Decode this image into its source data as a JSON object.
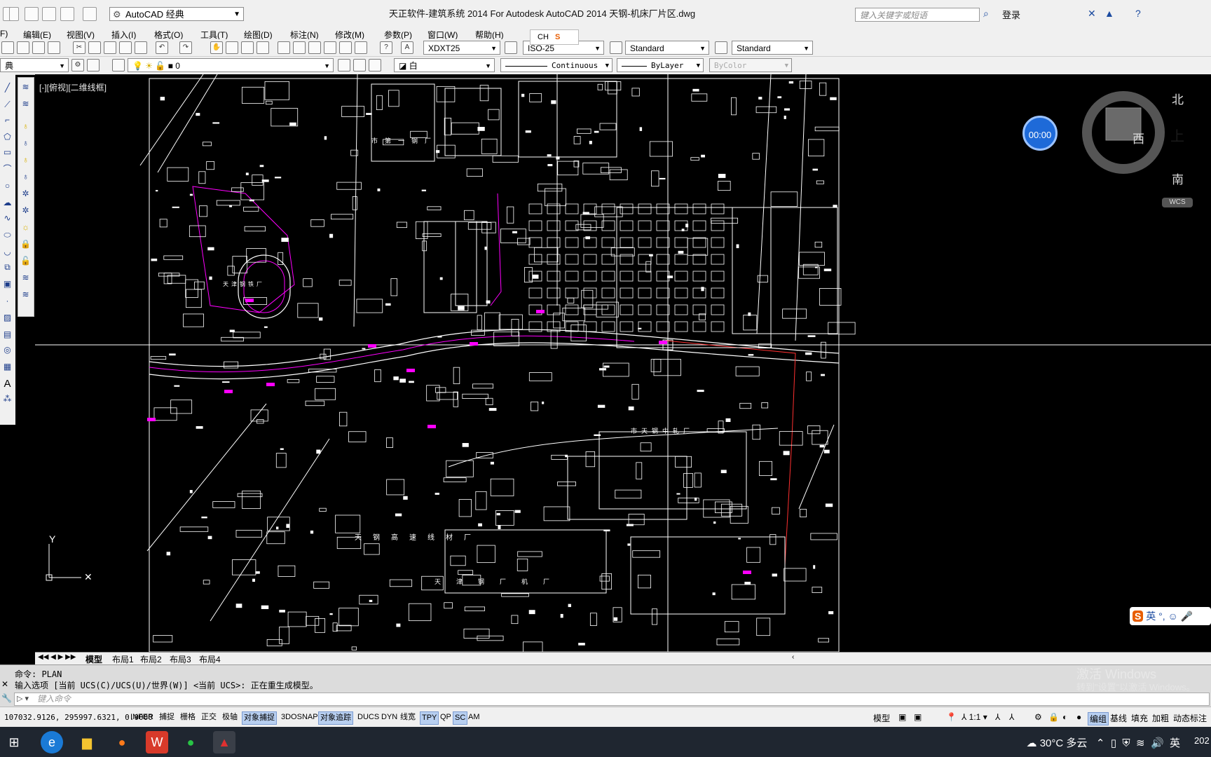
{
  "titlebar": {
    "workspace": "AutoCAD 经典",
    "title": "天正软件-建筑系统 2014  For Autodesk AutoCAD 2014      天钢-机床厂片区.dwg",
    "search_placeholder": "键入关键字或短语",
    "login": "登录"
  },
  "menu": [
    "F)",
    "编辑(E)",
    "视图(V)",
    "插入(I)",
    "格式(O)",
    "工具(T)",
    "绘图(D)",
    "标注(N)",
    "修改(M)",
    "参数(P)",
    "窗口(W)",
    "帮助(H)"
  ],
  "ime": {
    "label": "CH",
    "mode": "英"
  },
  "toolbar1": {
    "text_style": "XDXT25",
    "dim_style": "ISO-25",
    "table_style": "Standard",
    "multileader_style": "Standard"
  },
  "toolbar2": {
    "workspace_short": "典",
    "layer": "0",
    "color": "白",
    "linetype": "Continuous",
    "lineweight": "ByLayer",
    "plotstyle": "ByColor"
  },
  "viewport": {
    "label": "[-][俯视][二维线框]",
    "timer": "00:00",
    "compass": {
      "north": "北",
      "south": "南",
      "west": "西",
      "top": "上"
    },
    "wcs": "WCS",
    "ucs_y": "Y",
    "map_labels": [
      "天钢高速线材厂",
      "天津钢厂机厂",
      "市天钢中轧厂",
      "市第一钢厂",
      "天津钢铁厂"
    ]
  },
  "tabs": [
    "模型",
    "布局1",
    "布局2",
    "布局3",
    "布局4"
  ],
  "command": {
    "line1": "命令: PLAN",
    "line2": "输入选项 [当前 UCS(C)/UCS(U)/世界(W)] <当前 UCS>:  正在重生成模型。",
    "placeholder": "键入命令"
  },
  "watermark": {
    "line1": "激活 Windows",
    "line2": "转到\"设置\"以激活 Windows。"
  },
  "statusbar": {
    "coords": "107032.9126, 295997.6321, 0.0000",
    "toggles": [
      {
        "label": "INFER",
        "on": false
      },
      {
        "label": "捕捉",
        "on": false
      },
      {
        "label": "栅格",
        "on": false
      },
      {
        "label": "正交",
        "on": false
      },
      {
        "label": "极轴",
        "on": false
      },
      {
        "label": "对象捕捉",
        "on": true
      },
      {
        "label": "3DOSNAP",
        "on": false
      },
      {
        "label": "对象追踪",
        "on": true
      },
      {
        "label": "DUCS",
        "on": false
      },
      {
        "label": "DYN",
        "on": false
      },
      {
        "label": "线宽",
        "on": false
      },
      {
        "label": "TPY",
        "on": true
      },
      {
        "label": "QP",
        "on": false
      },
      {
        "label": "SC",
        "on": true
      },
      {
        "label": "AM",
        "on": false
      }
    ],
    "model": "模型",
    "scale": "1:1",
    "right_items": [
      "编组",
      "基线",
      "填充",
      "加粗",
      "动态标注"
    ]
  },
  "taskbar": {
    "weather": "30°C  多云",
    "clock": "202"
  },
  "colors": {
    "accent": "#1e6ad8",
    "magenta": "#ff00ff",
    "drawing_bg": "#000000",
    "toggle_on": "#b8cff0"
  }
}
